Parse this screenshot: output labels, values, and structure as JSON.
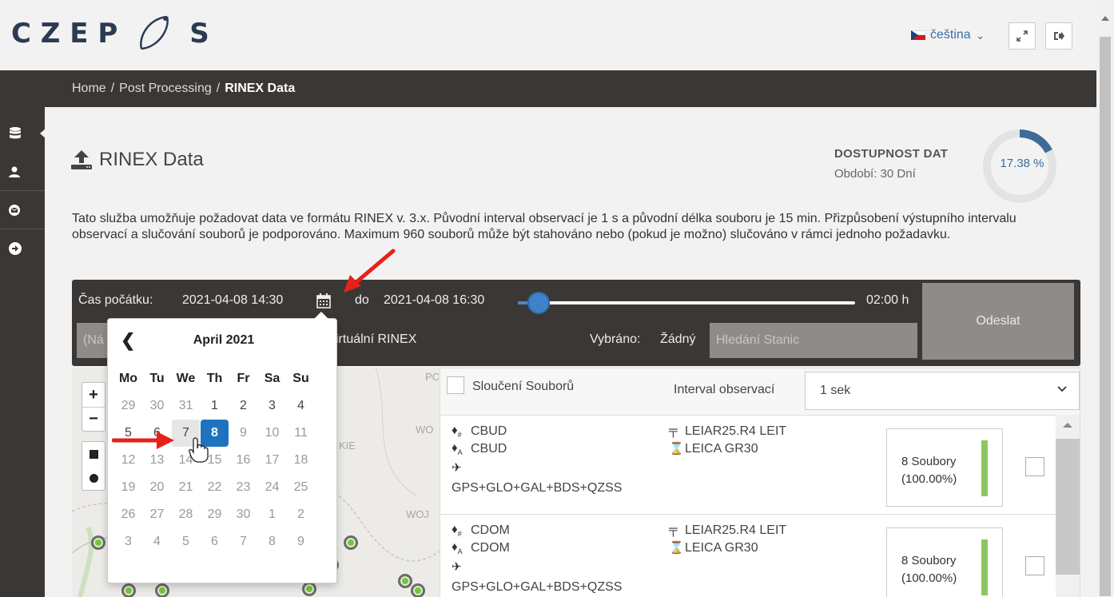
{
  "header": {
    "logo_left": "C Z E P",
    "logo_right": "S",
    "language": "čeština",
    "language_caret": "⌄"
  },
  "breadcrumb": {
    "items": [
      "Home",
      "Post Processing"
    ],
    "separator": "/",
    "current": "RINEX Data"
  },
  "sidebar": {
    "items": [
      "database-icon",
      "user-icon",
      "envelope-icon",
      "arrow-right-circle-icon"
    ],
    "active_index": 0
  },
  "page": {
    "title": "RINEX Data",
    "availability_title": "DOSTUPNOST DAT",
    "availability_period": "Období: 30 Dní",
    "availability_value": "17.38 %",
    "availability_fraction": 0.1738,
    "description": "Tato služba umožňuje požadovat data ve formátu RINEX v. 3.x. Původní interval observací je 1 s a původní délka souboru je 15 min. Přizpůsobení výstupního intervalu observací a slučování souborů je podporováno. Maximum 960 souborů může být stahováno nebo (pokud je možno) slučováno v rámci jednoho požadavku."
  },
  "filter": {
    "start_label": "Čas počátku:",
    "start_value": "2021-04-08 14:30",
    "to_label": "do",
    "end_value": "2021-04-08 16:30",
    "duration": "02:00 h",
    "submit_label": "Odeslat",
    "name_placeholder": "(Ná",
    "virtual_label": "irtuální RINEX",
    "selected_label": "Vybráno:",
    "selected_value": "Žádný",
    "search_placeholder": "Hledání Stanic"
  },
  "datepicker": {
    "prev": "❮",
    "title": "April 2021",
    "weekdays": [
      "Mo",
      "Tu",
      "We",
      "Th",
      "Fr",
      "Sa",
      "Su"
    ],
    "days": [
      [
        "29",
        "30",
        "31",
        "1",
        "2",
        "3",
        "4"
      ],
      [
        "5",
        "6",
        "7",
        "8",
        "9",
        "10",
        "11"
      ],
      [
        "12",
        "13",
        "14",
        "15",
        "16",
        "17",
        "18"
      ],
      [
        "19",
        "20",
        "21",
        "22",
        "23",
        "24",
        "25"
      ],
      [
        "26",
        "27",
        "28",
        "29",
        "30",
        "1",
        "2"
      ],
      [
        "3",
        "4",
        "5",
        "6",
        "7",
        "8",
        "9"
      ]
    ],
    "selected": "8",
    "hover": "7"
  },
  "map": {
    "places": [
      "PC",
      "WO",
      "KIE",
      "WOJ"
    ],
    "zoom_in": "+",
    "zoom_out": "−"
  },
  "panel": {
    "merge_label": "Sloučení Souborů",
    "interval_label": "Interval observací",
    "interval_value": "1 sek",
    "stations": [
      {
        "name_marker": "CBUD",
        "name_antenna": "CBUD",
        "gnss": "GPS+GLO+GAL+BDS+QZSS",
        "antenna": "LEIAR25.R4 LEIT",
        "receiver": "LEICA GR30",
        "files_count": "8 Soubory",
        "files_pct": "(100.00%)",
        "fill_fraction": 1.0
      },
      {
        "name_marker": "CDOM",
        "name_antenna": "CDOM",
        "gnss": "GPS+GLO+GAL+BDS+QZSS",
        "antenna": "LEIAR25.R4 LEIT",
        "receiver": "LEICA GR30",
        "files_count": "8 Soubory",
        "files_pct": "(100.00%)",
        "fill_fraction": 1.0
      }
    ]
  },
  "colors": {
    "dark": "#3a3735",
    "accent": "#1e73be",
    "availability": "#3d6c99",
    "files_ok": "#8cc760",
    "annotation_arrow": "#e8201b"
  }
}
